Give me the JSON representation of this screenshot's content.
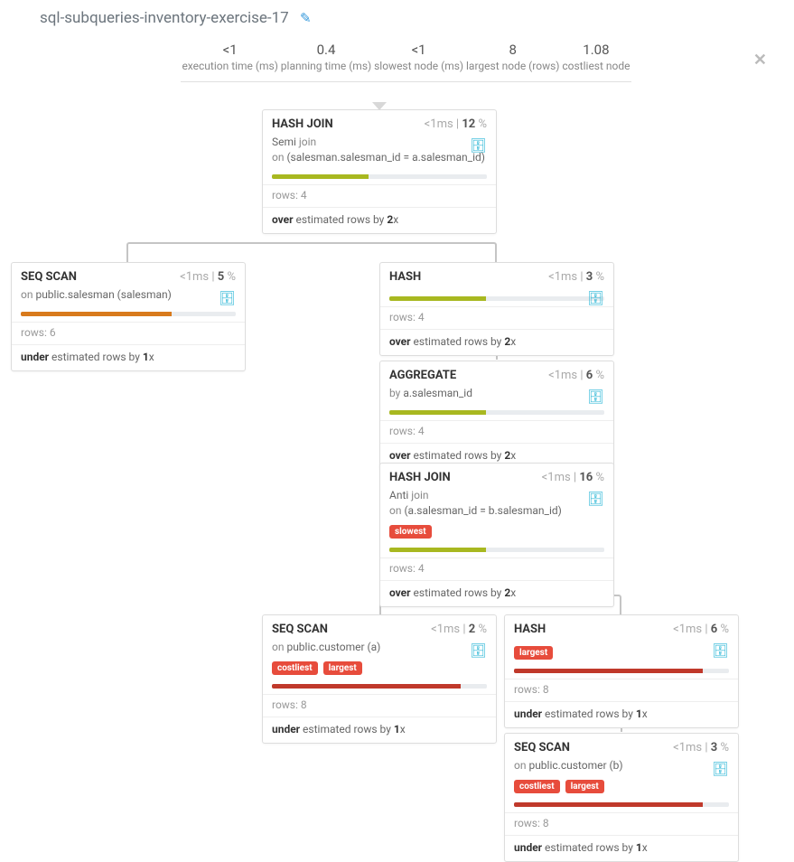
{
  "title": "sql-subqueries-inventory-exercise-17",
  "stats": [
    {
      "val": "<1",
      "label": "execution time (ms)"
    },
    {
      "val": "0.4",
      "label": "planning time (ms)"
    },
    {
      "val": "<1",
      "label": "slowest node (ms)"
    },
    {
      "val": "8",
      "label": "largest node (rows)"
    },
    {
      "val": "1.08",
      "label": "costliest node"
    }
  ],
  "labels": {
    "rows_prefix": "rows: ",
    "ms_suffix": "ms",
    "pct_suffix": " %",
    "sep": " | ",
    "on": "on ",
    "by": "by ",
    "join_word": " join"
  },
  "tags": {
    "slowest": "slowest",
    "largest": "largest",
    "costliest": "costliest"
  },
  "nodes": {
    "n1": {
      "name": "HASH JOIN",
      "time": "<1",
      "pct": "12",
      "join_kind": "Semi",
      "on_cond": "(salesman.salesman_id = a.salesman_id)",
      "rows": "4",
      "est_pre": "over",
      "est_mid": " estimated rows by ",
      "est_mult": "2",
      "est_suf": "x",
      "bar_pct": 45,
      "bar_color": "olive"
    },
    "n2": {
      "name": "SEQ SCAN",
      "time": "<1",
      "pct": "5",
      "scan_on": "public.salesman (salesman)",
      "rows": "6",
      "est_pre": "under",
      "est_mid": " estimated rows by ",
      "est_mult": "1",
      "est_suf": "x",
      "bar_pct": 70,
      "bar_color": "orange"
    },
    "n3": {
      "name": "HASH",
      "time": "<1",
      "pct": "3",
      "rows": "4",
      "est_pre": "over",
      "est_mid": " estimated rows by ",
      "est_mult": "2",
      "est_suf": "x",
      "bar_pct": 45,
      "bar_color": "olive"
    },
    "n4": {
      "name": "AGGREGATE",
      "time": "<1",
      "pct": "6",
      "by_field": "a.salesman_id",
      "rows": "4",
      "est_pre": "over",
      "est_mid": " estimated rows by ",
      "est_mult": "2",
      "est_suf": "x",
      "bar_pct": 45,
      "bar_color": "olive"
    },
    "n5": {
      "name": "HASH JOIN",
      "time": "<1",
      "pct": "16",
      "join_kind": "Anti",
      "on_cond": "(a.salesman_id = b.salesman_id)",
      "rows": "4",
      "est_pre": "over",
      "est_mid": " estimated rows by ",
      "est_mult": "2",
      "est_suf": "x",
      "bar_pct": 45,
      "bar_color": "olive"
    },
    "n6": {
      "name": "SEQ SCAN",
      "time": "<1",
      "pct": "2",
      "scan_on": "public.customer (a)",
      "rows": "8",
      "est_pre": "under",
      "est_mid": " estimated rows by ",
      "est_mult": "1",
      "est_suf": "x",
      "bar_pct": 88,
      "bar_color": "red"
    },
    "n7": {
      "name": "HASH",
      "time": "<1",
      "pct": "6",
      "rows": "8",
      "est_pre": "under",
      "est_mid": " estimated rows by ",
      "est_mult": "1",
      "est_suf": "x",
      "bar_pct": 88,
      "bar_color": "red"
    },
    "n8": {
      "name": "SEQ SCAN",
      "time": "<1",
      "pct": "3",
      "scan_on": "public.customer (b)",
      "rows": "8",
      "est_pre": "under",
      "est_mid": " estimated rows by ",
      "est_mult": "1",
      "est_suf": "x",
      "bar_pct": 88,
      "bar_color": "red"
    }
  }
}
